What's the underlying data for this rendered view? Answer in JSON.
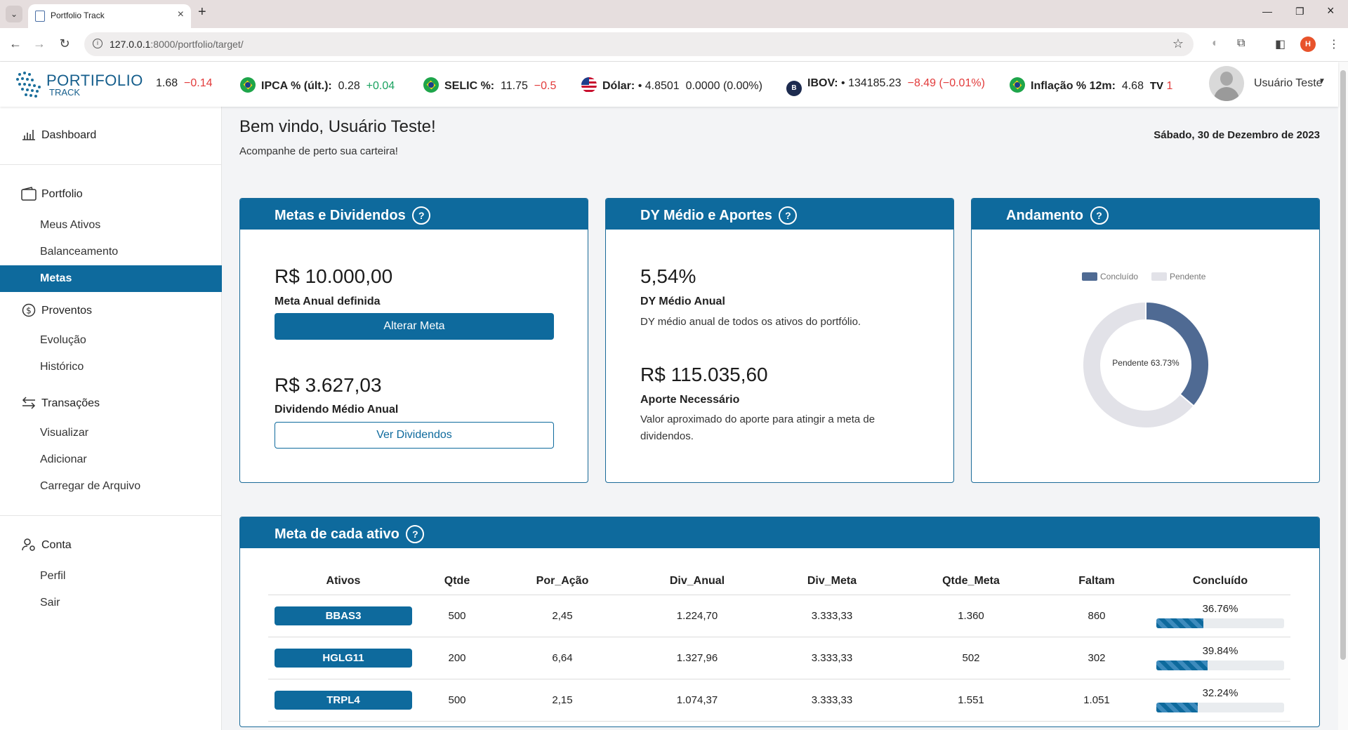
{
  "browser": {
    "tab_title": "Portfolio Track",
    "url_host": "127.0.0.1",
    "url_rest": ":8000/portfolio/target/",
    "profile_initial": "H"
  },
  "brand": {
    "title": "PORTIFOLIO",
    "subtitle": "TRACK"
  },
  "ticker": [
    {
      "label": "",
      "value": "1.68",
      "change": "−0.14",
      "dir": "neg",
      "flag": ""
    },
    {
      "label": "IPCA % (últ.):",
      "value": "0.28",
      "change": "+0.04",
      "dir": "pos",
      "flag": "br"
    },
    {
      "label": "SELIC %:",
      "value": "11.75",
      "change": "−0.5",
      "dir": "neg",
      "flag": "br"
    },
    {
      "label": "Dólar:",
      "value": "• 4.8501",
      "change": "0.0000 (0.00%)",
      "dir": "flat",
      "flag": "us"
    },
    {
      "label": "IBOV:",
      "value": "• 134185.23",
      "change": "−8.49 (−0.01%)",
      "dir": "neg",
      "flag": "b3"
    },
    {
      "label": "Inflação % 12m:",
      "value": "4.68",
      "change": "1",
      "dir": "neg",
      "flag": "br"
    }
  ],
  "user": {
    "name": "Usuário Teste"
  },
  "sidebar": {
    "dashboard": "Dashboard",
    "portfolio": "Portfolio",
    "portfolio_items": [
      "Meus Ativos",
      "Balanceamento",
      "Metas"
    ],
    "proventos": "Proventos",
    "proventos_items": [
      "Evolução",
      "Histórico"
    ],
    "transacoes": "Transações",
    "transacoes_items": [
      "Visualizar",
      "Adicionar",
      "Carregar de Arquivo"
    ],
    "conta": "Conta",
    "conta_items": [
      "Perfil",
      "Sair"
    ],
    "active": "Metas"
  },
  "header": {
    "welcome": "Bem vindo, Usuário Teste!",
    "subtitle": "Acompanhe de perto sua carteira!",
    "date": "Sábado, 30 de Dezembro de 2023"
  },
  "metas": {
    "title": "Metas e Dividendos",
    "meta_value": "R$ 10.000,00",
    "meta_label": "Meta Anual definida",
    "alter_button": "Alterar Meta",
    "div_value": "R$ 3.627,03",
    "div_label": "Dividendo Médio Anual",
    "ver_button": "Ver Dividendos"
  },
  "dy": {
    "title": "DY Médio e Aportes",
    "dy_value": "5,54%",
    "dy_label": "DY Médio Anual",
    "dy_desc": "DY médio anual de todos os ativos do portfólio.",
    "aporte_value": "R$ 115.035,60",
    "aporte_label": "Aporte Necessário",
    "aporte_desc": "Valor aproximado do aporte para atingir a meta de dividendos."
  },
  "andamento": {
    "title": "Andamento",
    "legend_done": "Concluído",
    "legend_pending": "Pendente",
    "center_label": "Pendente 63.73%",
    "colors": {
      "done": "#4f6a93",
      "pending": "#e2e2e8"
    }
  },
  "chart_data": {
    "type": "pie",
    "categories": [
      "Concluído",
      "Pendente"
    ],
    "values": [
      36.27,
      63.73
    ]
  },
  "table": {
    "title": "Meta de cada ativo",
    "headers": [
      "Ativos",
      "Qtde",
      "Por_Ação",
      "Div_Anual",
      "Div_Meta",
      "Qtde_Meta",
      "Faltam",
      "Concluído"
    ],
    "rows": [
      {
        "ativo": "BBAS3",
        "qtde": "500",
        "por_acao": "2,45",
        "div_anual": "1.224,70",
        "div_meta": "3.333,33",
        "qtde_meta": "1.360",
        "faltam": "860",
        "concluido": "36.76%",
        "pct": 36.76
      },
      {
        "ativo": "HGLG11",
        "qtde": "200",
        "por_acao": "6,64",
        "div_anual": "1.327,96",
        "div_meta": "3.333,33",
        "qtde_meta": "502",
        "faltam": "302",
        "concluido": "39.84%",
        "pct": 39.84
      },
      {
        "ativo": "TRPL4",
        "qtde": "500",
        "por_acao": "2,15",
        "div_anual": "1.074,37",
        "div_meta": "3.333,33",
        "qtde_meta": "1.551",
        "faltam": "1.051",
        "concluido": "32.24%",
        "pct": 32.24
      }
    ]
  }
}
